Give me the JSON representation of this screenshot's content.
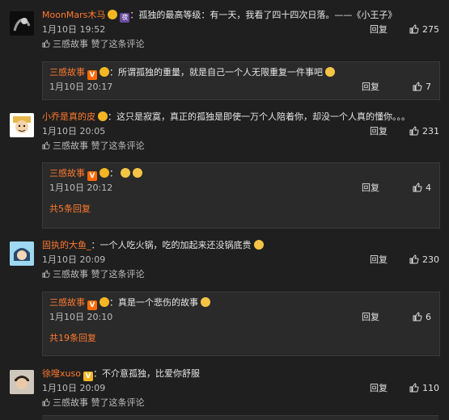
{
  "comments": [
    {
      "username": "MoonMars木马",
      "text": "：孤独的最高等级：有一天，我看了四十四次日落。——《小王子》",
      "time": "1月10日 19:52",
      "reply_label": "回复",
      "likes": "275",
      "liked_by_author": "三感故事 赞了这条评论",
      "badges": [
        "crown",
        "night"
      ],
      "night_badge_text": "夜",
      "subreply": {
        "username": "三感故事",
        "text": "：所谓孤独的重量，就是自己一个人无限重复一件事吧",
        "time": "1月10日 20:17",
        "reply_label": "回复",
        "likes": "7"
      }
    },
    {
      "username": "小乔是真的皮",
      "text": "：这只是寂寞，真正的孤独是即使一万个人陪着你，却没一个人真的懂你。。。",
      "time": "1月10日 20:05",
      "reply_label": "回复",
      "likes": "231",
      "liked_by_author": "三感故事 赞了这条评论",
      "subreply": {
        "username": "三感故事",
        "text": "：",
        "time": "1月10日 20:12",
        "reply_label": "回复",
        "likes": "4",
        "more": "共5条回复"
      }
    },
    {
      "username": "固执的大鱼_",
      "text": "：一个人吃火锅，吃的加起来还没锅底贵",
      "time": "1月10日 20:09",
      "reply_label": "回复",
      "likes": "230",
      "liked_by_author": "三感故事 赞了这条评论",
      "subreply": {
        "username": "三感故事",
        "text": "：真是一个悲伤的故事",
        "time": "1月10日 20:10",
        "reply_label": "回复",
        "likes": "6",
        "more": "共19条回复"
      }
    },
    {
      "username": "徐嗖xuso",
      "text": "：不介意孤独，比爱你舒服",
      "time": "1月10日 20:09",
      "reply_label": "回复",
      "likes": "110",
      "liked_by_author": "三感故事 赞了这条评论"
    }
  ],
  "badge_v_text": "V"
}
